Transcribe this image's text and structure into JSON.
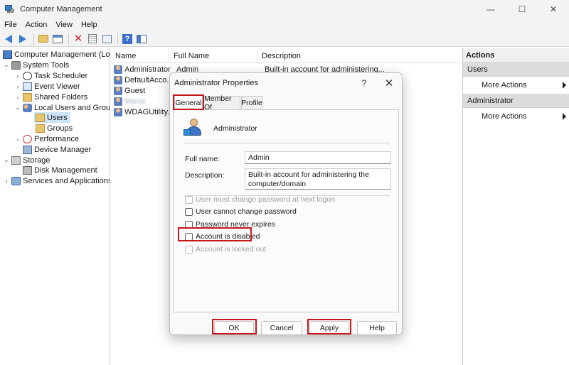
{
  "window": {
    "title": "Computer Management",
    "minimize": "—",
    "maximize": "☐",
    "close": "✕"
  },
  "menu": [
    "File",
    "Action",
    "View",
    "Help"
  ],
  "tree": [
    {
      "label": "Computer Management (Local",
      "chev": "",
      "icon": "t-comp"
    },
    {
      "label": "System Tools",
      "chev": "⌄",
      "icon": "t-tools"
    },
    {
      "label": "Task Scheduler",
      "chev": "›",
      "icon": "t-clock"
    },
    {
      "label": "Event Viewer",
      "chev": "›",
      "icon": "t-event"
    },
    {
      "label": "Shared Folders",
      "chev": "›",
      "icon": "t-folder"
    },
    {
      "label": "Local Users and Groups",
      "chev": "⌄",
      "icon": "t-users"
    },
    {
      "label": "Users",
      "chev": "",
      "icon": "t-folder"
    },
    {
      "label": "Groups",
      "chev": "",
      "icon": "t-folder"
    },
    {
      "label": "Performance",
      "chev": "›",
      "icon": "t-perf"
    },
    {
      "label": "Device Manager",
      "chev": "",
      "icon": "t-device"
    },
    {
      "label": "Storage",
      "chev": "⌄",
      "icon": "t-storage"
    },
    {
      "label": "Disk Management",
      "chev": "",
      "icon": "t-disk"
    },
    {
      "label": "Services and Applications",
      "chev": "›",
      "icon": "t-services"
    }
  ],
  "list": {
    "columns": [
      "Name",
      "Full Name",
      "Description"
    ],
    "rows": [
      {
        "name": "Administrator",
        "full_name": "Admin",
        "description": "Built-in account for administering..."
      },
      {
        "name": "DefaultAcco...",
        "full_name": "",
        "description": ""
      },
      {
        "name": "Guest",
        "full_name": "",
        "description": ""
      },
      {
        "name": "Mansi",
        "full_name": "",
        "description": ""
      },
      {
        "name": "WDAGUtility...",
        "full_name": "",
        "description": ""
      }
    ]
  },
  "actions": {
    "title": "Actions",
    "sections": [
      {
        "label": "Users",
        "items": [
          "More Actions"
        ]
      },
      {
        "label": "Administrator",
        "items": [
          "More Actions"
        ]
      }
    ]
  },
  "dialog": {
    "title": "Administrator Properties",
    "help": "?",
    "close": "✕",
    "tabs": [
      "General",
      "Member Of",
      "Profile"
    ],
    "user_name": "Administrator",
    "full_name_label": "Full name:",
    "full_name_value": "Admin",
    "description_label": "Description:",
    "description_value": "Built-in account for administering the computer/domain",
    "checkboxes": [
      {
        "label": "User must change password at next logon",
        "checked": false,
        "enabled": false
      },
      {
        "label": "User cannot change password",
        "checked": false,
        "enabled": true
      },
      {
        "label": "Password never expires",
        "checked": false,
        "enabled": true
      },
      {
        "label": "Account is disabled",
        "checked": false,
        "enabled": true
      },
      {
        "label": "Account is locked out",
        "checked": false,
        "enabled": false
      }
    ],
    "buttons": {
      "ok": "OK",
      "cancel": "Cancel",
      "apply": "Apply",
      "help": "Help"
    }
  },
  "colors": {
    "highlight": "#c4161c",
    "selection": "#cce4f7"
  }
}
